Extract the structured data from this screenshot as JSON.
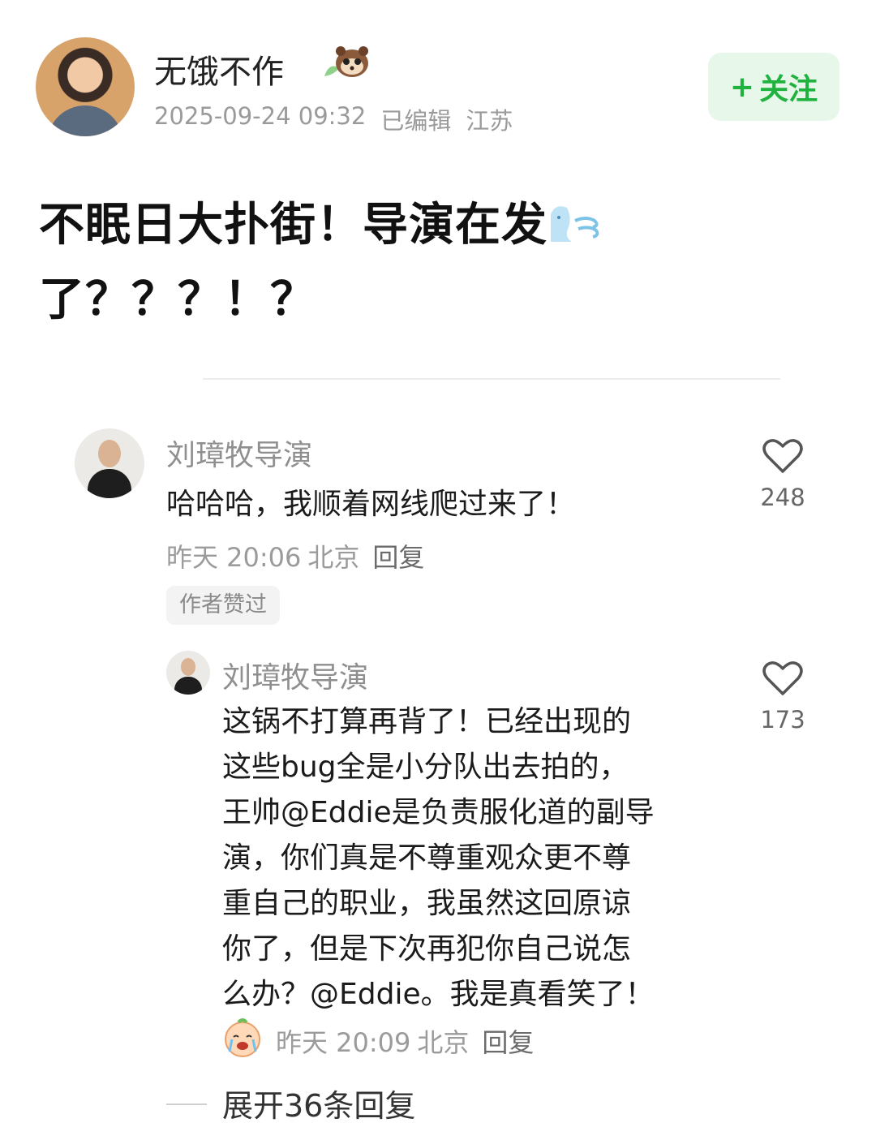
{
  "post": {
    "author": "无饿不作",
    "timestamp": "2025-09-24 09:32",
    "edited": "已编辑",
    "location": "江苏",
    "follow_label": "关注",
    "title_line1": "不眠日大扑街！导演在发",
    "title_line2": "了？？？！？"
  },
  "comments": [
    {
      "author": "刘璋牧导演",
      "text": "哈哈哈，我顺着网线爬过来了！",
      "time": "昨天 20:06",
      "location": "北京",
      "reply_label": "回复",
      "likes": "248",
      "badge": "作者赞过"
    },
    {
      "author": "刘璋牧导演",
      "text_lines": [
        "这锅不打算再背了！已经出现的",
        "这些bug全是小分队出去拍的，",
        "王帅@Eddie是负责服化道的副导",
        "演，你们真是不尊重观众更不尊",
        "重自己的职业，我虽然这回原谅",
        "你了，但是下次再犯你自己说怎",
        "么办？@Eddie。我是真看笑了！"
      ],
      "time": "昨天 20:09",
      "location": "北京",
      "reply_label": "回复",
      "likes": "173"
    }
  ],
  "expand_label": "展开36条回复",
  "colors": {
    "accent": "#1fb23f",
    "follow_bg": "#e7f8ea",
    "muted": "#9a9a9a"
  },
  "icons": [
    "plus-icon",
    "heart-icon",
    "raccoon-sticker-icon",
    "wind-emoji-icon",
    "crying-emoji-icon"
  ]
}
